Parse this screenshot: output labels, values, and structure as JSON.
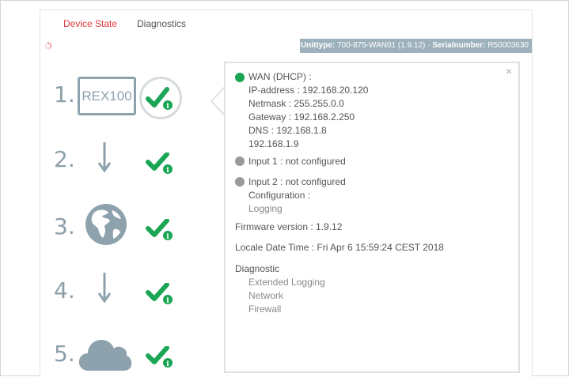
{
  "tabs": [
    {
      "label": "Device State",
      "active": true
    },
    {
      "label": "Diagnostics",
      "active": false
    }
  ],
  "infobar": {
    "unittype_label": "Unittype:",
    "unittype_value": "700-875-WAN01 (1.9.12)",
    "separator": "·",
    "serial_label": "Serialnumber:",
    "serial_value": "R50003630"
  },
  "steps": [
    {
      "number": "1.",
      "device_label": "REX100",
      "icon": "device-box",
      "status": "ok"
    },
    {
      "number": "2.",
      "icon": "arrow-down-icon",
      "status": "ok"
    },
    {
      "number": "3.",
      "icon": "globe-icon",
      "status": "ok"
    },
    {
      "number": "4.",
      "icon": "arrow-down-icon",
      "status": "ok"
    },
    {
      "number": "5.",
      "icon": "cloud-icon",
      "status": "ok"
    }
  ],
  "popover": {
    "close": "×",
    "wan": {
      "title": "WAN (DHCP) :",
      "status_color": "#1aa655",
      "ip": "IP-address : 192.168.20.120",
      "netmask": "Netmask : 255.255.0.0",
      "gateway": "Gateway : 192.168.2.250",
      "dns": "DNS : 192.168.1.8",
      "dns2": "192.168.1.9"
    },
    "input1": {
      "label": "Input 1 : not configured",
      "status_color": "#9a9a9a"
    },
    "input2": {
      "label": "Input 2 : not configured",
      "status_color": "#9a9a9a",
      "configuration": "Configuration :",
      "logging": "Logging"
    },
    "firmware": "Firmware version : 1.9.12",
    "datetime": "Locale Date Time : Fri Apr 6 15:59:24 CEST 2018",
    "diagnostic": {
      "title": "Diagnostic",
      "items": [
        "Extended Logging",
        "Network",
        "Firewall"
      ]
    }
  },
  "colors": {
    "accent_red": "#e03a3e",
    "check_green": "#1aa655",
    "icon_gray": "#8ea2ad"
  }
}
